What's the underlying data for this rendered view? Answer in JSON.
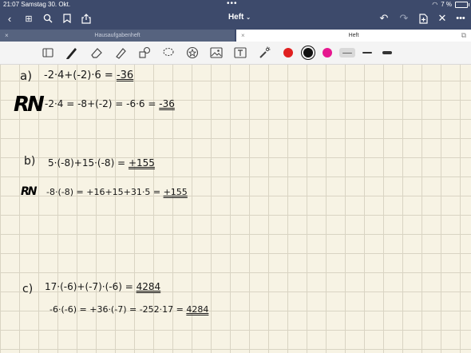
{
  "status_bar": {
    "time_date": "21:07  Samstag 30. Okt.",
    "battery": "7 %"
  },
  "nav": {
    "back_icon": "chevron-left-icon",
    "grid_icon": "grid-icon",
    "search_icon": "search-icon",
    "bookmark_icon": "bookmark-icon",
    "share_icon": "share-icon",
    "title": "Heft",
    "undo_icon": "undo-icon",
    "redo_icon": "redo-icon",
    "add_page_icon": "add-page-icon",
    "close_icon": "close-icon",
    "more_icon": "more-icon"
  },
  "tabs": [
    {
      "label": "Hausaufgabenheft",
      "active": false
    },
    {
      "label": "Heft",
      "active": true
    }
  ],
  "toolbar": {
    "tools": [
      "reader-icon",
      "pen-icon",
      "eraser-icon",
      "highlighter-icon",
      "shapes-icon",
      "lasso-icon",
      "sticker-icon",
      "image-icon",
      "text-icon",
      "laser-pointer-icon"
    ],
    "colors": [
      "#e02020",
      "#111111",
      "#e6178f"
    ],
    "line_widths": [
      "thin",
      "medium",
      "thick"
    ]
  },
  "notes": {
    "a_label": "a)",
    "a_line1": "-2·4+(-2)·6 = ",
    "a_line1_result": "-36",
    "rn1": "RN",
    "a_line2": "-2·4 = -8+(-2) = -6·6 = ",
    "a_line2_result": "-36",
    "b_label": "b)",
    "b_line1": "5·(-8)+15·(-8) = ",
    "b_line1_result": "+155",
    "rn2": "RN",
    "b_line2": "-8·(-8) = +16+15+31·5 = ",
    "b_line2_result": "+155",
    "c_label": "c)",
    "c_line1": "17·(-6)+(-7)·(-6) = ",
    "c_line1_result": "4284",
    "c_line2": "-6·(-6) = +36·(-7) = -252·17 = ",
    "c_line2_result": "4284"
  }
}
